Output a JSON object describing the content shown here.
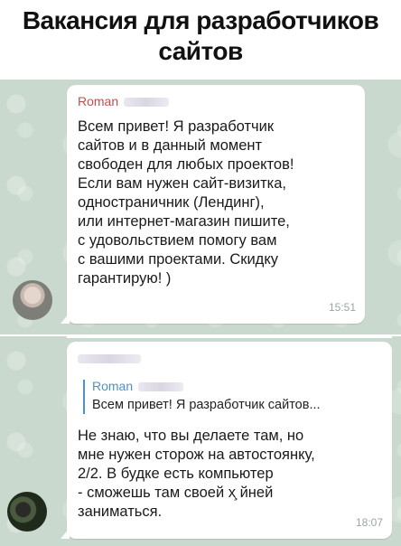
{
  "headline": "Вакансия для разработчиков сайтов",
  "message_1": {
    "sender": "Roman",
    "text": "Всем привет! Я разработчик\nсайтов и в данный момент\nсвободен для любых проектов!\nЕсли вам нужен сайт-визитка,\nодностраничник (Лендинг),\nили интернет-магазин пишите,\nс удовольствием помогу вам\nс вашими проектами. Скидку\nгарантирую! )",
    "time": "15:51"
  },
  "message_2": {
    "reply_sender": "Roman",
    "reply_quote": "Всем привет! Я разработчик сайтов...",
    "text": "Не знаю, что вы делаете там, но\nмне нужен сторож на автостоянку,\n2/2. В будке есть компьютер\n- сможешь там своей х̧ йней\nзаниматься.",
    "time": "18:07"
  },
  "icons": {
    "avatar_1": "user-avatar",
    "avatar_2": "user-avatar"
  },
  "colors": {
    "sender_name": "#c0504d",
    "reply_accent": "#4a90d9",
    "chat_background": "#c9d9cd"
  }
}
